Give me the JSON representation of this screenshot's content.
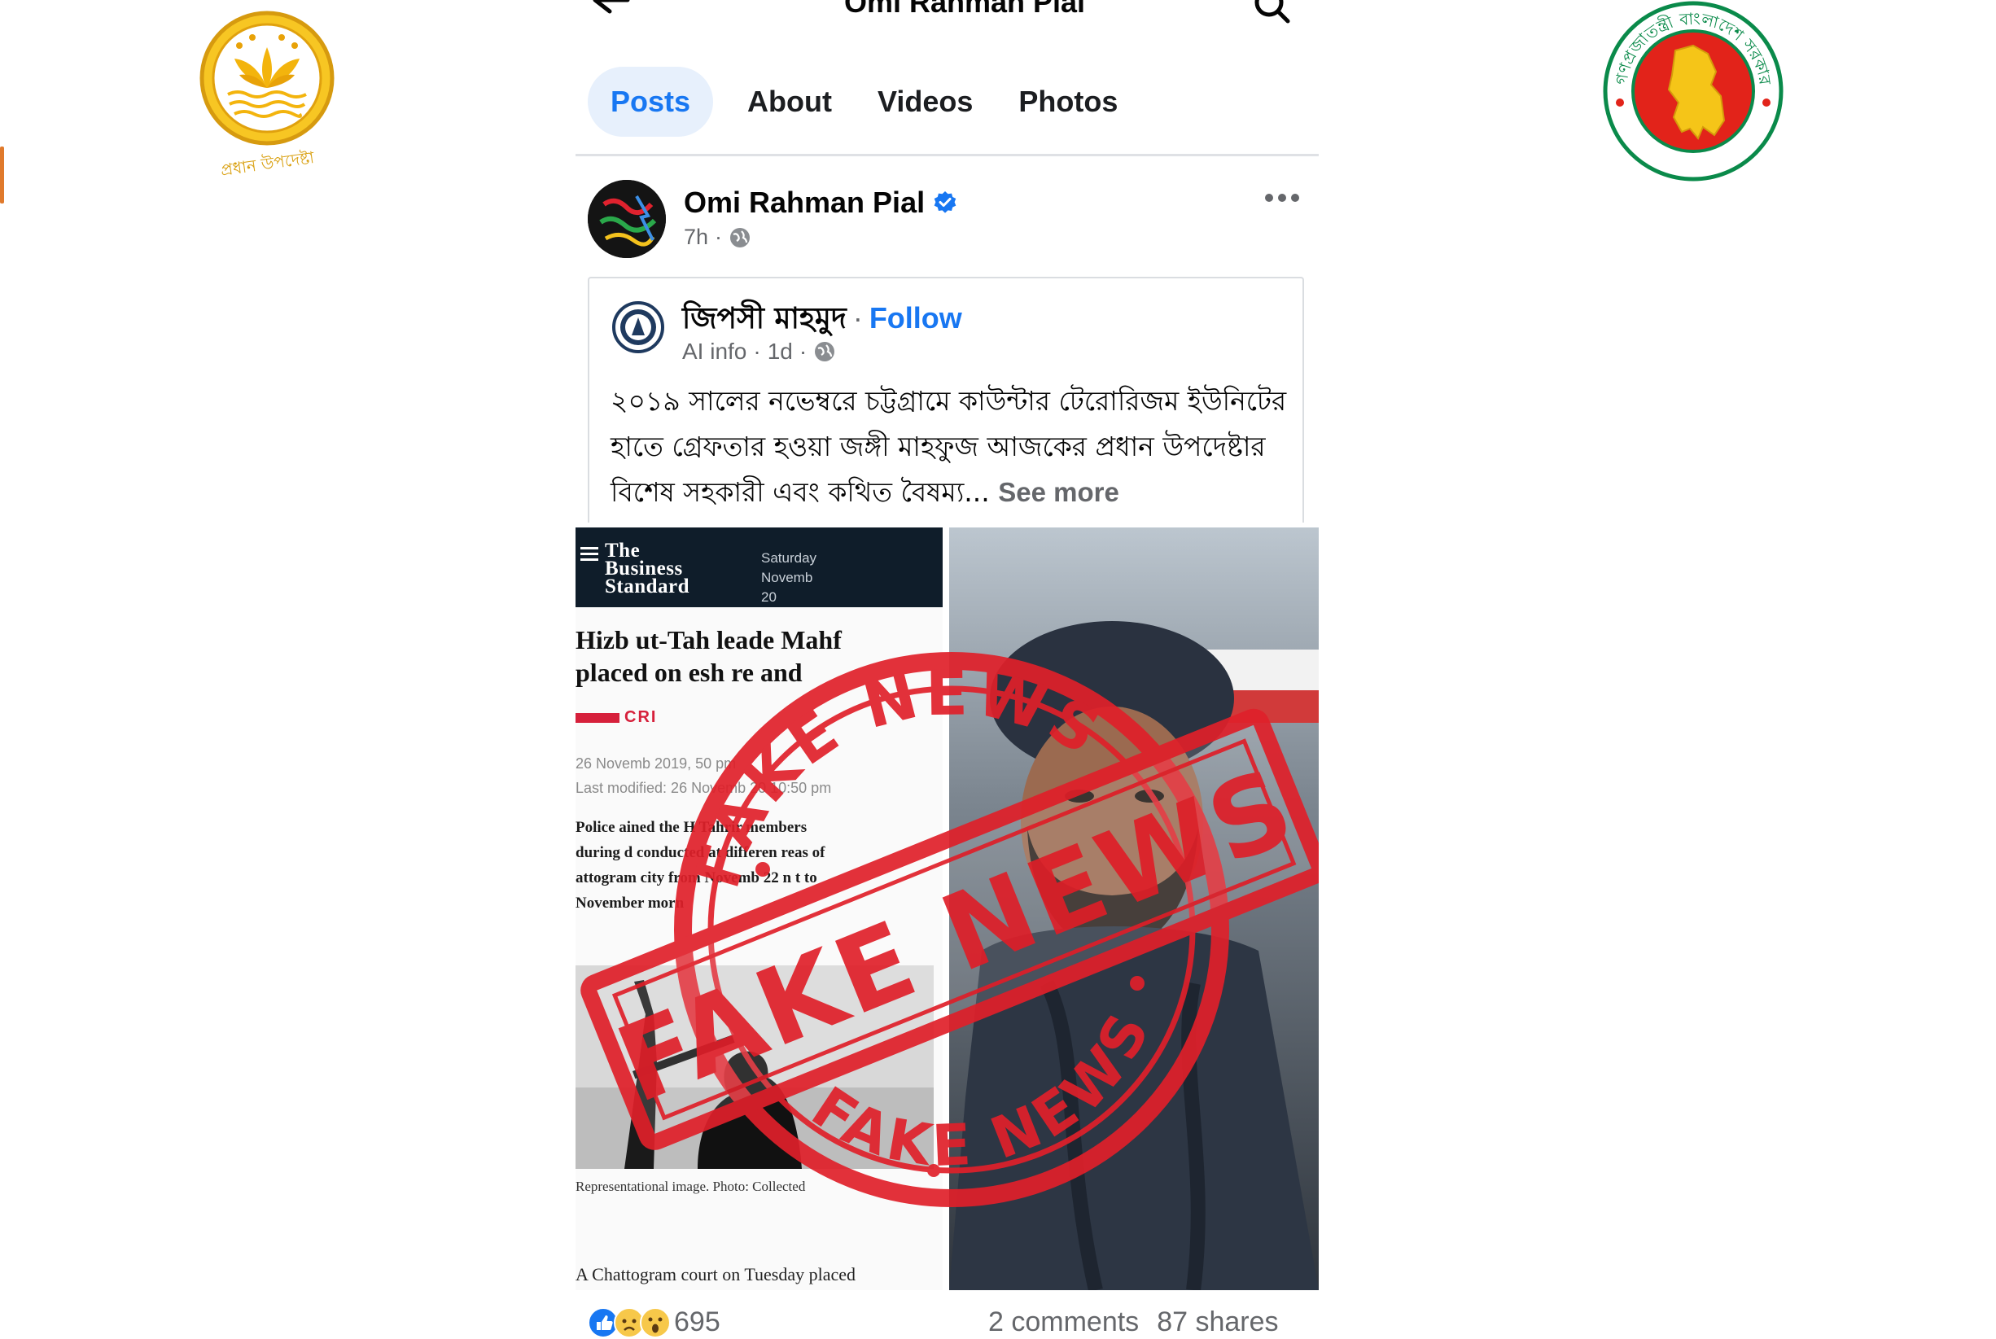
{
  "header": {
    "title": "Omi Rahman Pial"
  },
  "tabs": [
    {
      "label": "Posts",
      "active": true
    },
    {
      "label": "About",
      "active": false
    },
    {
      "label": "Videos",
      "active": false
    },
    {
      "label": "Photos",
      "active": false
    }
  ],
  "post": {
    "author": "Omi Rahman Pial",
    "verified": true,
    "time": "7h",
    "shared": {
      "author": "জিপসী মাহমুদ",
      "separator": "·",
      "follow_label": "Follow",
      "meta_label": "AI info",
      "time": "1d",
      "text": "২০১৯ সালের নভেম্বরে চট্টগ্রামে কাউন্টার টেরোরিজম ইউনিটের হাতে গ্রেফতার হওয়া জঙ্গী মাহফুজ আজকের প্রধান উপদেষ্টার বিশেষ সহকারী এবং কথিত বৈষম্য...",
      "see_more": "See more"
    },
    "image": {
      "logo_line1": "The",
      "logo_line2": "Business",
      "logo_line3": "Standard",
      "date_day": "Saturday",
      "date_rest": "Novemb",
      "date_year": "20",
      "headline_line1": "Hizb ut-Tah   leade  Mahf",
      "headline_line2": "placed on  esh  re  and",
      "section": "CRI",
      "date_published": "26 Novemb  2019,    50 pm",
      "date_modified": "Last modified: 26 Novemb   20   10:50 pm",
      "lede_line1": "Police    ained the H       Tahrir members",
      "lede_line2": "during d      conducted at differen  reas of",
      "lede_line3": "  attogram city from Novemb  22 n  t to",
      "lede_line4": "November    morn",
      "caption": "Representational image. Photo: Collected",
      "body_line": "A Chattogram court on Tuesday placed",
      "stamp_text": "FAKE NEWS"
    },
    "reactions_count": "695",
    "comments": "2 comments",
    "shares": "87 shares"
  },
  "emblems": {
    "left_text": "প্রধান উপদেষ্টা",
    "right_text": "গণপ্রজাতন্ত্রী বাংলাদেশ সরকার"
  },
  "colors": {
    "accent": "#1877f2",
    "stamp_red": "#e0202a",
    "emblem_gold": "#f0b419",
    "emblem_green": "#0a8a4a",
    "emblem_red": "#e2231a"
  }
}
